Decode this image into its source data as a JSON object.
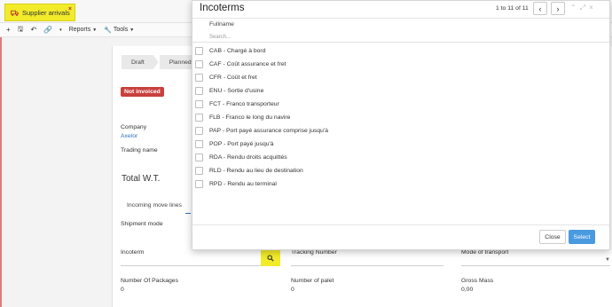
{
  "tab": {
    "label": "Supplier arrivals",
    "close": "×"
  },
  "toolbar": {
    "add": "+",
    "save": "🖫",
    "back": "↶",
    "attach": "🔗",
    "more": "▾",
    "reports": "Reports",
    "tools": "Tools"
  },
  "form": {
    "steps": [
      "Draft",
      "Planned"
    ],
    "badge": "Not invoiced",
    "company_label": "Company",
    "company_value": "Axelor",
    "trading_label": "Trading name",
    "total_label": "Total W.T.",
    "subtab": "Incoming move lines",
    "shipment_label": "Shipment mode",
    "incoterm_label": "Incoterm",
    "tracking_label": "Tracking Number",
    "mode_label": "Mode of transport",
    "packages_label": "Number Of Packages",
    "packages_value": "0",
    "palet_label": "Number of palet",
    "palet_value": "0",
    "gross_label": "Gross Mass",
    "gross_value": "0,00"
  },
  "modal": {
    "title": "Incoterms",
    "pager": "1 to 11 of 11",
    "column": "Fullname",
    "search_placeholder": "Search...",
    "rows": [
      "CAB - Chargé à bord",
      "CAF - Coût assurance et fret",
      "CFR - Coût et fret",
      "ENU - Sortie d'usine",
      "FCT - Franco transporteur",
      "FLB - Franco le long du navire",
      "PAP - Port payé assurance comprise jusqu'à",
      "POP - Port payé jusqu'à",
      "RDA - Rendu droits acquittés",
      "RLD - Rendu au lieu de destination",
      "RPD - Rendu au terminal"
    ],
    "close_label": "Close",
    "select_label": "Select"
  },
  "colors": {
    "accent": "#4a9ae0",
    "highlight": "#f2eb2a",
    "badge": "#c9403d",
    "link": "#2f71b8"
  }
}
